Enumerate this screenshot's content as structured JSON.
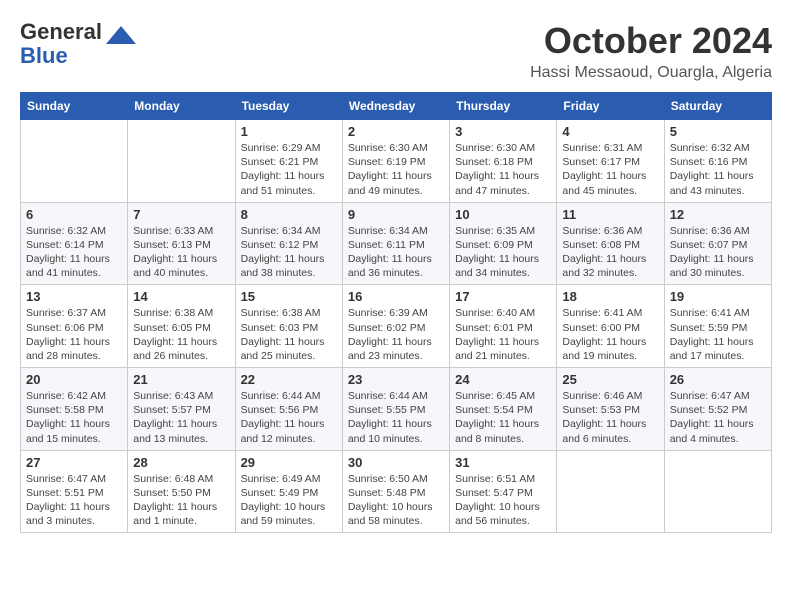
{
  "header": {
    "logo_line1": "General",
    "logo_line2": "Blue",
    "month_title": "October 2024",
    "location": "Hassi Messaoud, Ouargla, Algeria"
  },
  "weekdays": [
    "Sunday",
    "Monday",
    "Tuesday",
    "Wednesday",
    "Thursday",
    "Friday",
    "Saturday"
  ],
  "weeks": [
    [
      {
        "day": "",
        "info": ""
      },
      {
        "day": "",
        "info": ""
      },
      {
        "day": "1",
        "info": "Sunrise: 6:29 AM\nSunset: 6:21 PM\nDaylight: 11 hours and 51 minutes."
      },
      {
        "day": "2",
        "info": "Sunrise: 6:30 AM\nSunset: 6:19 PM\nDaylight: 11 hours and 49 minutes."
      },
      {
        "day": "3",
        "info": "Sunrise: 6:30 AM\nSunset: 6:18 PM\nDaylight: 11 hours and 47 minutes."
      },
      {
        "day": "4",
        "info": "Sunrise: 6:31 AM\nSunset: 6:17 PM\nDaylight: 11 hours and 45 minutes."
      },
      {
        "day": "5",
        "info": "Sunrise: 6:32 AM\nSunset: 6:16 PM\nDaylight: 11 hours and 43 minutes."
      }
    ],
    [
      {
        "day": "6",
        "info": "Sunrise: 6:32 AM\nSunset: 6:14 PM\nDaylight: 11 hours and 41 minutes."
      },
      {
        "day": "7",
        "info": "Sunrise: 6:33 AM\nSunset: 6:13 PM\nDaylight: 11 hours and 40 minutes."
      },
      {
        "day": "8",
        "info": "Sunrise: 6:34 AM\nSunset: 6:12 PM\nDaylight: 11 hours and 38 minutes."
      },
      {
        "day": "9",
        "info": "Sunrise: 6:34 AM\nSunset: 6:11 PM\nDaylight: 11 hours and 36 minutes."
      },
      {
        "day": "10",
        "info": "Sunrise: 6:35 AM\nSunset: 6:09 PM\nDaylight: 11 hours and 34 minutes."
      },
      {
        "day": "11",
        "info": "Sunrise: 6:36 AM\nSunset: 6:08 PM\nDaylight: 11 hours and 32 minutes."
      },
      {
        "day": "12",
        "info": "Sunrise: 6:36 AM\nSunset: 6:07 PM\nDaylight: 11 hours and 30 minutes."
      }
    ],
    [
      {
        "day": "13",
        "info": "Sunrise: 6:37 AM\nSunset: 6:06 PM\nDaylight: 11 hours and 28 minutes."
      },
      {
        "day": "14",
        "info": "Sunrise: 6:38 AM\nSunset: 6:05 PM\nDaylight: 11 hours and 26 minutes."
      },
      {
        "day": "15",
        "info": "Sunrise: 6:38 AM\nSunset: 6:03 PM\nDaylight: 11 hours and 25 minutes."
      },
      {
        "day": "16",
        "info": "Sunrise: 6:39 AM\nSunset: 6:02 PM\nDaylight: 11 hours and 23 minutes."
      },
      {
        "day": "17",
        "info": "Sunrise: 6:40 AM\nSunset: 6:01 PM\nDaylight: 11 hours and 21 minutes."
      },
      {
        "day": "18",
        "info": "Sunrise: 6:41 AM\nSunset: 6:00 PM\nDaylight: 11 hours and 19 minutes."
      },
      {
        "day": "19",
        "info": "Sunrise: 6:41 AM\nSunset: 5:59 PM\nDaylight: 11 hours and 17 minutes."
      }
    ],
    [
      {
        "day": "20",
        "info": "Sunrise: 6:42 AM\nSunset: 5:58 PM\nDaylight: 11 hours and 15 minutes."
      },
      {
        "day": "21",
        "info": "Sunrise: 6:43 AM\nSunset: 5:57 PM\nDaylight: 11 hours and 13 minutes."
      },
      {
        "day": "22",
        "info": "Sunrise: 6:44 AM\nSunset: 5:56 PM\nDaylight: 11 hours and 12 minutes."
      },
      {
        "day": "23",
        "info": "Sunrise: 6:44 AM\nSunset: 5:55 PM\nDaylight: 11 hours and 10 minutes."
      },
      {
        "day": "24",
        "info": "Sunrise: 6:45 AM\nSunset: 5:54 PM\nDaylight: 11 hours and 8 minutes."
      },
      {
        "day": "25",
        "info": "Sunrise: 6:46 AM\nSunset: 5:53 PM\nDaylight: 11 hours and 6 minutes."
      },
      {
        "day": "26",
        "info": "Sunrise: 6:47 AM\nSunset: 5:52 PM\nDaylight: 11 hours and 4 minutes."
      }
    ],
    [
      {
        "day": "27",
        "info": "Sunrise: 6:47 AM\nSunset: 5:51 PM\nDaylight: 11 hours and 3 minutes."
      },
      {
        "day": "28",
        "info": "Sunrise: 6:48 AM\nSunset: 5:50 PM\nDaylight: 11 hours and 1 minute."
      },
      {
        "day": "29",
        "info": "Sunrise: 6:49 AM\nSunset: 5:49 PM\nDaylight: 10 hours and 59 minutes."
      },
      {
        "day": "30",
        "info": "Sunrise: 6:50 AM\nSunset: 5:48 PM\nDaylight: 10 hours and 58 minutes."
      },
      {
        "day": "31",
        "info": "Sunrise: 6:51 AM\nSunset: 5:47 PM\nDaylight: 10 hours and 56 minutes."
      },
      {
        "day": "",
        "info": ""
      },
      {
        "day": "",
        "info": ""
      }
    ]
  ]
}
